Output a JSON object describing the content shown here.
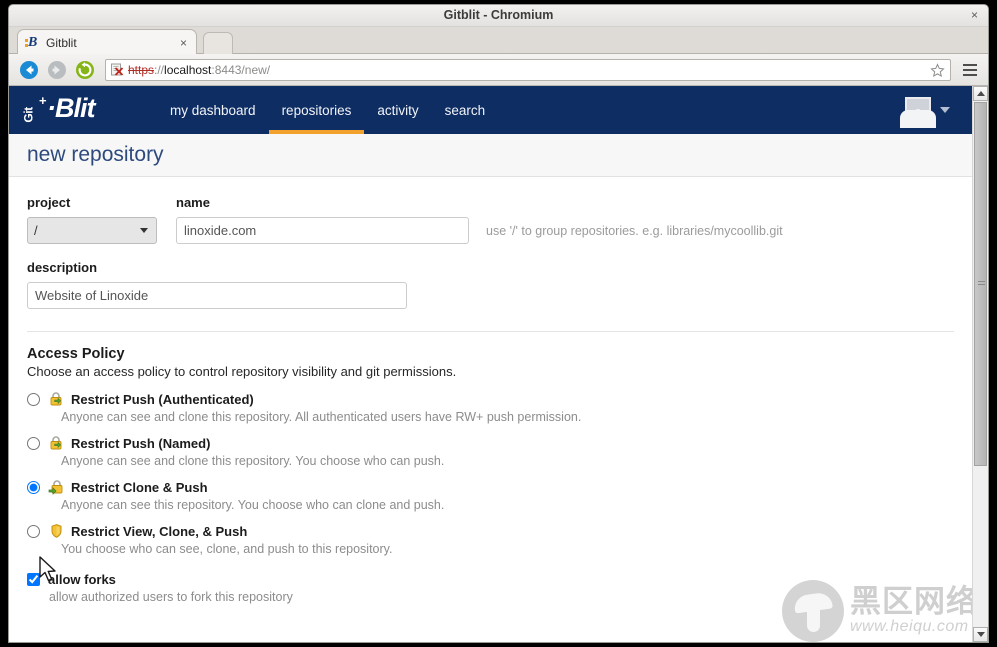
{
  "window": {
    "title": "Gitblit - Chromium",
    "close_label": "×"
  },
  "tabs": [
    {
      "title": "Gitblit",
      "favicon": "gitblit-favicon",
      "close_label": "×"
    }
  ],
  "newtab": {
    "label": ""
  },
  "toolbar": {
    "back_label": "back-arrow-icon",
    "forward_label": "forward-arrow-icon",
    "reload_label": "reload-icon",
    "url_scheme": "https",
    "url_separator": "://",
    "url_host": "localhost",
    "url_rest": ":8443/new/",
    "url_full": "https://localhost:8443/new/",
    "security_icon": "broken-certificate-icon",
    "bookmark_label": "star-icon",
    "menu_label": "hamburger-menu-icon"
  },
  "site": {
    "logo": {
      "git": "Git",
      "plus": "+",
      "blit": "·Blit"
    },
    "nav": [
      {
        "label": "my dashboard",
        "active": false
      },
      {
        "label": "repositories",
        "active": true
      },
      {
        "label": "activity",
        "active": false
      },
      {
        "label": "search",
        "active": false
      }
    ],
    "account": {
      "avatar": "user-avatar-placeholder",
      "caret": "chevron-down-icon"
    },
    "accent_color": "#f2a22c",
    "navbar_color": "#0e2d63"
  },
  "page": {
    "title": "new repository",
    "project": {
      "label": "project",
      "value": "/",
      "options": [
        "/"
      ]
    },
    "name": {
      "label": "name",
      "value": "linoxide.com",
      "placeholder": "",
      "hint": "use '/' to group repositories. e.g. libraries/mycoollib.git"
    },
    "description": {
      "label": "description",
      "value": "Website of Linoxide",
      "placeholder": ""
    },
    "access_policy": {
      "title": "Access Policy",
      "subtitle": "Choose an access policy to control repository visibility and git permissions.",
      "options": [
        {
          "name": "Restrict Push (Authenticated)",
          "description": "Anyone can see and clone this repository. All authenticated users have RW+ push permission.",
          "icon": "padlock-push-icon",
          "selected": false
        },
        {
          "name": "Restrict Push (Named)",
          "description": "Anyone can see and clone this repository. You choose who can push.",
          "icon": "padlock-push-icon",
          "selected": false
        },
        {
          "name": "Restrict Clone & Push",
          "description": "Anyone can see this repository. You choose who can clone and push.",
          "icon": "padlock-clone-push-icon",
          "selected": true
        },
        {
          "name": "Restrict View, Clone, & Push",
          "description": "You choose who can see, clone, and push to this repository.",
          "icon": "shield-icon",
          "selected": false
        }
      ]
    },
    "allow_forks": {
      "label": "allow forks",
      "description": "allow authorized users to fork this repository",
      "checked": true
    }
  },
  "scrollbar": {
    "up_label": "scroll-up-arrow",
    "down_label": "scroll-down-arrow"
  },
  "watermark": {
    "cn": "黑区网络",
    "url": "www.heiqu.com"
  }
}
